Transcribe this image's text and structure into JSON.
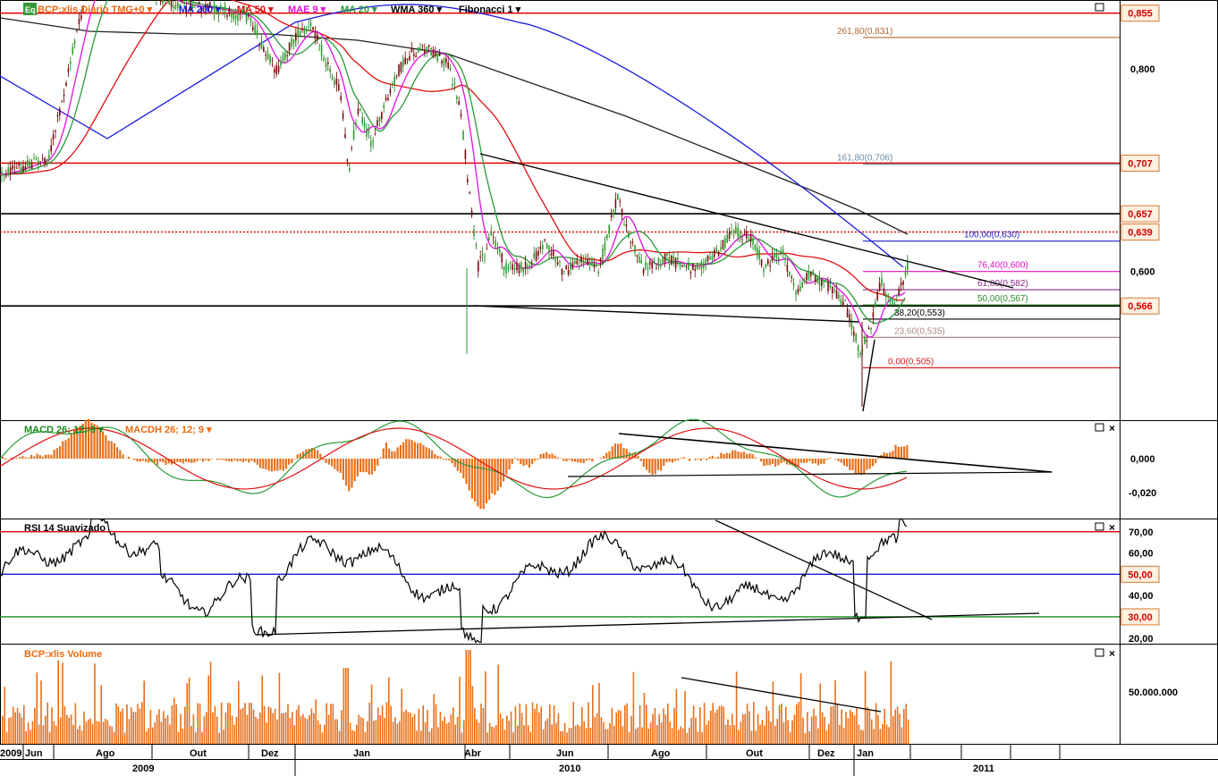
{
  "header": {
    "logo": "Eq",
    "items": [
      {
        "label": "BCP:xlis Diário TMG+0",
        "color": "#e86a10"
      },
      {
        "label": "MA 200",
        "color": "#1a1adc"
      },
      {
        "label": "MA 50",
        "color": "#e01010"
      },
      {
        "label": "MAE 9",
        "color": "#e010e0"
      },
      {
        "label": "MA 20",
        "color": "#2a9a3a"
      },
      {
        "label": "WMA 360",
        "color": "#000000"
      },
      {
        "label": "Fibonacci 1",
        "color": "#000000"
      }
    ],
    "dropdown_glyph": "▾"
  },
  "price_axis": {
    "ticks": [
      "0,800",
      "0,600"
    ],
    "badges": [
      {
        "label": "0,855",
        "value": 0.855,
        "line_color": "#e01010",
        "style": "solid"
      },
      {
        "label": "0,707",
        "value": 0.707,
        "line_color": "#e01010",
        "style": "solid"
      },
      {
        "label": "0,657",
        "value": 0.657,
        "line_color": "#000000",
        "style": "solid"
      },
      {
        "label": "0,639",
        "value": 0.639,
        "line_color": "#e01010",
        "style": "dotted"
      },
      {
        "label": "0,566",
        "value": 0.566,
        "line_color": "#000000",
        "style": "solid"
      }
    ]
  },
  "fibonacci": [
    {
      "label": "261,80(0,831)",
      "value": 0.831,
      "color": "#b06a30"
    },
    {
      "label": "161,80(0,706)",
      "value": 0.706,
      "color": "#6e8aa0"
    },
    {
      "label": "100,00(0,630)",
      "value": 0.63,
      "color": "#2020c8"
    },
    {
      "label": "76,40(0,600)",
      "value": 0.6,
      "color": "#e010c8"
    },
    {
      "label": "61,80(0,582)",
      "value": 0.582,
      "color": "#8a2a8a"
    },
    {
      "label": "50,00(0,567)",
      "value": 0.567,
      "color": "#2a8a2a"
    },
    {
      "label": "38,20(0,553)",
      "value": 0.553,
      "color": "#000000"
    },
    {
      "label": "23,60(0,535)",
      "value": 0.535,
      "color": "#b08a8a"
    },
    {
      "label": "0,00(0,505)",
      "value": 0.505,
      "color": "#d42020"
    }
  ],
  "macd_panel": {
    "title_macd": "MACD 26; 12; 9",
    "title_macdh": "MACDH 26; 12; 9",
    "ticks": [
      "0,000",
      "-0,020"
    ]
  },
  "rsi_panel": {
    "title": "RSI 14 Suavizado",
    "ticks": [
      "70,00",
      "60,00",
      "40,00",
      "20,00"
    ],
    "badges": [
      {
        "label": "50,00",
        "value": 50
      },
      {
        "label": "30,00",
        "value": 30
      }
    ]
  },
  "volume_panel": {
    "title": "BCP:xlis Volume",
    "ticks": [
      "50.000.000"
    ]
  },
  "time_axis": {
    "months": [
      "2009",
      "Jun",
      "Ago",
      "Out",
      "Dez",
      "Jan",
      "Abr",
      "Jun",
      "Ago",
      "Out",
      "Dez",
      "Jan"
    ],
    "years": [
      "2009",
      "2010",
      "2011"
    ]
  },
  "window_controls": {
    "maximize": "□",
    "close": "×"
  },
  "chart_data": [
    {
      "type": "candlestick",
      "series": [
        {
          "name": "BCP:xlis Diário TMG+0"
        },
        {
          "name": "MA 200"
        },
        {
          "name": "MA 50"
        },
        {
          "name": "MAE 9"
        },
        {
          "name": "MA 20"
        },
        {
          "name": "WMA 360"
        }
      ],
      "x_range": [
        "2009-05",
        "2011-01"
      ],
      "ylim": [
        0.49,
        0.865
      ],
      "horizontal_levels": [
        0.855,
        0.707,
        0.657,
        0.639,
        0.566
      ],
      "fibonacci_levels": [
        0.831,
        0.706,
        0.63,
        0.6,
        0.582,
        0.567,
        0.553,
        0.535,
        0.505
      ],
      "approx_path": [
        {
          "date": "2009-05",
          "close": 0.72
        },
        {
          "date": "2009-06",
          "close": 0.73
        },
        {
          "date": "2009-07",
          "close": 0.82
        },
        {
          "date": "2009-08",
          "close": 0.89
        },
        {
          "date": "2009-09",
          "close": 0.93
        },
        {
          "date": "2009-10",
          "close": 0.87
        },
        {
          "date": "2009-11",
          "close": 0.87
        },
        {
          "date": "2009-12",
          "close": 0.83
        },
        {
          "date": "2010-01",
          "close": 0.8
        },
        {
          "date": "2010-02",
          "close": 0.74
        },
        {
          "date": "2010-03",
          "close": 0.83
        },
        {
          "date": "2010-04",
          "close": 0.66
        },
        {
          "date": "2010-05",
          "close": 0.63
        },
        {
          "date": "2010-06",
          "close": 0.62
        },
        {
          "date": "2010-07",
          "close": 0.66
        },
        {
          "date": "2010-08",
          "close": 0.63
        },
        {
          "date": "2010-09",
          "close": 0.64
        },
        {
          "date": "2010-10",
          "close": 0.63
        },
        {
          "date": "2010-11",
          "close": 0.62
        },
        {
          "date": "2010-12",
          "close": 0.58
        },
        {
          "date": "2011-01",
          "close": 0.639
        }
      ]
    },
    {
      "type": "line",
      "series": [
        {
          "name": "MACD 26; 12; 9"
        },
        {
          "name": "MACDH 26; 12; 9"
        }
      ],
      "yticks": [
        0.0,
        -0.02
      ]
    },
    {
      "type": "line",
      "series": [
        {
          "name": "RSI 14 Suavizado"
        }
      ],
      "ylim": [
        15,
        75
      ],
      "reference_lines": [
        70,
        50,
        30
      ],
      "yticks": [
        70,
        60,
        50,
        40,
        30,
        20
      ]
    },
    {
      "type": "bar",
      "series": [
        {
          "name": "BCP:xlis Volume"
        }
      ],
      "yticks": [
        50000000
      ]
    }
  ]
}
